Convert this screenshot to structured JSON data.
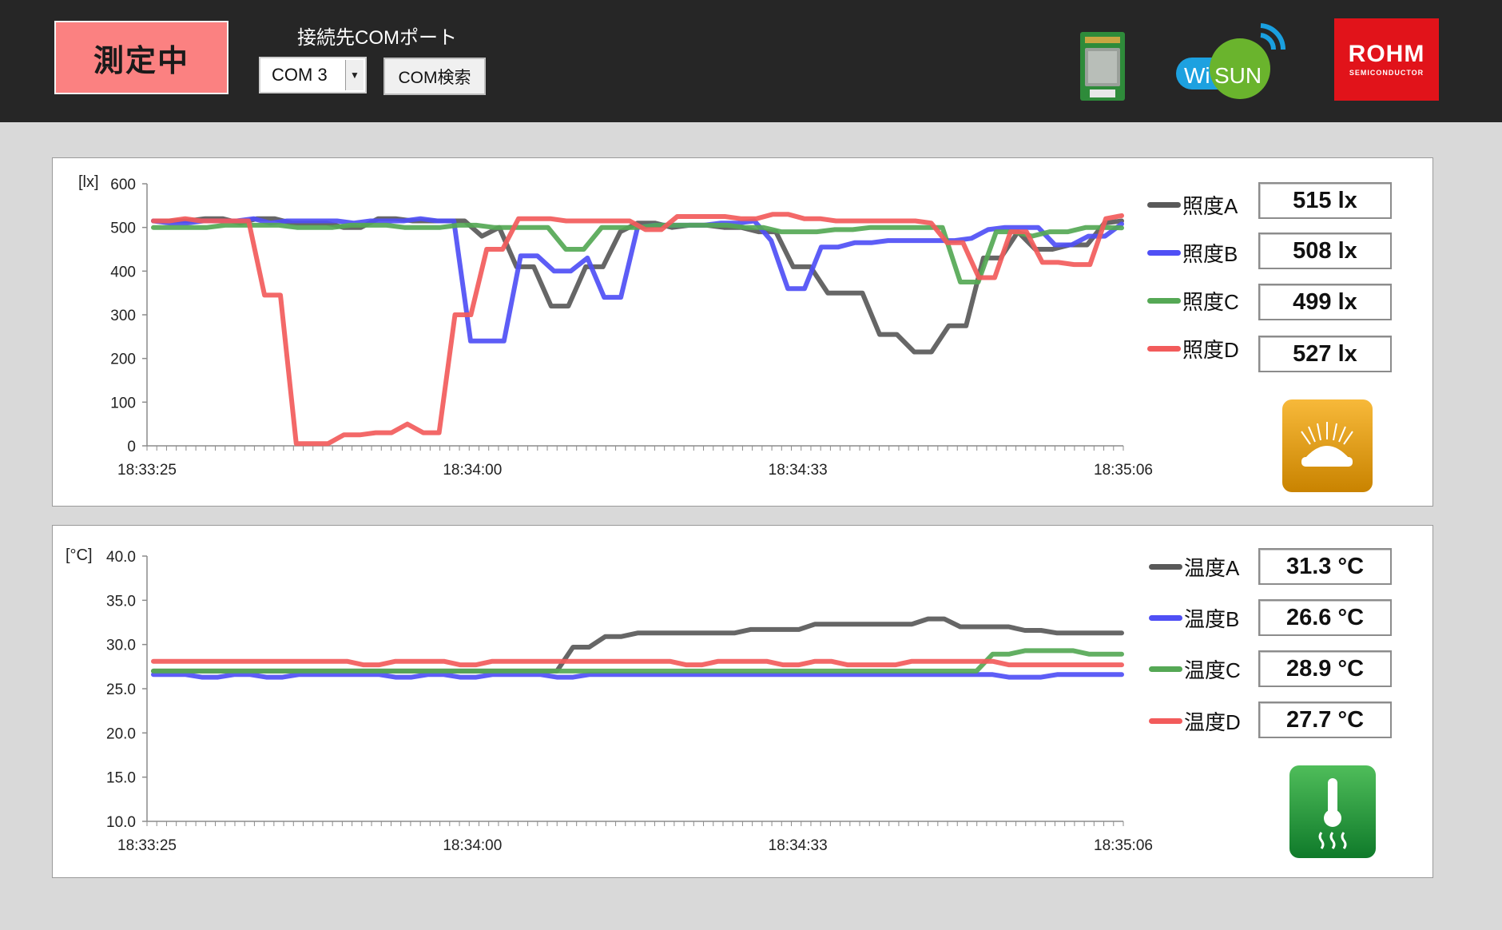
{
  "header": {
    "status_label": "測定中",
    "com_port_label": "接続先COMポート",
    "com_port_value": "COM 3",
    "com_search_label": "COM検索",
    "wisun_logo": "Wi SUN",
    "rohm_logo": "ROHM",
    "rohm_sub": "SEMICONDUCTOR"
  },
  "colors": {
    "A": "#595959",
    "B": "#4f4ff5",
    "C": "#55a855",
    "D": "#f25b5b",
    "status": "#fb8181"
  },
  "lux_panel": {
    "unit_label": "[lx]",
    "legend": [
      {
        "name": "照度A",
        "value": "515 lx"
      },
      {
        "name": "照度B",
        "value": "508 lx"
      },
      {
        "name": "照度C",
        "value": "499 lx"
      },
      {
        "name": "照度D",
        "value": "527 lx"
      }
    ],
    "icon": "light-sensor-icon"
  },
  "temp_panel": {
    "unit_label": "[°C]",
    "legend": [
      {
        "name": "温度A",
        "value": "31.3 °C"
      },
      {
        "name": "温度B",
        "value": "26.6 °C"
      },
      {
        "name": "温度C",
        "value": "28.9 °C"
      },
      {
        "name": "温度D",
        "value": "27.7 °C"
      }
    ],
    "icon": "thermometer-icon"
  },
  "chart_data": [
    {
      "type": "line",
      "ylabel": "[lx]",
      "ylim": [
        0,
        600
      ],
      "yticks": [
        "0",
        "100",
        "200",
        "300",
        "400",
        "500",
        "600"
      ],
      "xtick_labels": [
        "18:33:25",
        "18:34:00",
        "18:34:33",
        "18:35:06"
      ],
      "x": [
        0,
        2,
        4,
        6,
        8,
        10,
        12,
        14,
        16,
        18,
        20,
        22,
        24,
        26,
        28,
        30,
        32,
        34,
        36,
        38,
        40,
        42,
        44,
        46,
        48,
        50,
        52,
        54,
        56,
        58,
        60,
        62,
        64,
        66,
        68,
        70,
        72,
        74,
        76,
        78,
        80,
        82,
        84,
        86,
        88,
        90,
        92,
        94,
        96,
        98,
        100
      ],
      "series": [
        {
          "name": "照度A",
          "values": [
            515,
            515,
            515,
            520,
            520,
            510,
            520,
            520,
            510,
            510,
            510,
            500,
            500,
            520,
            520,
            515,
            515,
            515,
            515,
            480,
            500,
            410,
            410,
            320,
            320,
            410,
            410,
            490,
            510,
            510,
            500,
            505,
            505,
            500,
            500,
            490,
            490,
            410,
            410,
            350,
            350,
            350,
            255,
            255,
            215,
            215,
            275,
            275,
            430,
            430,
            490,
            450,
            450,
            460,
            460,
            510,
            515
          ]
        },
        {
          "name": "照度B",
          "values": [
            515,
            510,
            510,
            515,
            515,
            515,
            520,
            510,
            515,
            515,
            515,
            515,
            510,
            515,
            515,
            515,
            520,
            515,
            515,
            240,
            240,
            240,
            435,
            435,
            400,
            400,
            430,
            340,
            340,
            500,
            505,
            505,
            505,
            505,
            510,
            510,
            515,
            470,
            360,
            360,
            455,
            455,
            465,
            465,
            470,
            470,
            470,
            470,
            470,
            475,
            495,
            500,
            500,
            500,
            460,
            460,
            480,
            480,
            508
          ]
        },
        {
          "name": "照度C",
          "values": [
            500,
            500,
            500,
            500,
            505,
            505,
            505,
            505,
            500,
            500,
            500,
            505,
            505,
            505,
            500,
            500,
            500,
            505,
            505,
            500,
            500,
            500,
            500,
            450,
            450,
            500,
            500,
            500,
            505,
            505,
            505,
            505,
            505,
            500,
            500,
            490,
            490,
            490,
            495,
            495,
            500,
            500,
            500,
            500,
            500,
            375,
            375,
            490,
            490,
            480,
            490,
            490,
            500,
            500,
            499
          ]
        },
        {
          "name": "照度D",
          "values": [
            515,
            515,
            520,
            515,
            515,
            515,
            515,
            345,
            345,
            5,
            5,
            5,
            25,
            25,
            30,
            30,
            50,
            30,
            30,
            300,
            300,
            450,
            450,
            520,
            520,
            520,
            515,
            515,
            515,
            515,
            515,
            495,
            495,
            525,
            525,
            525,
            525,
            520,
            520,
            530,
            530,
            520,
            520,
            515,
            515,
            515,
            515,
            515,
            515,
            510,
            465,
            465,
            385,
            385,
            490,
            490,
            420,
            420,
            415,
            415,
            520,
            527
          ]
        }
      ]
    },
    {
      "type": "line",
      "ylabel": "[°C]",
      "ylim": [
        10,
        40
      ],
      "yticks": [
        "10.0",
        "15.0",
        "20.0",
        "25.0",
        "30.0",
        "35.0",
        "40.0"
      ],
      "xtick_labels": [
        "18:33:25",
        "18:34:00",
        "18:34:33",
        "18:35:06"
      ],
      "series": [
        {
          "name": "温度A",
          "values": [
            27.0,
            27.0,
            27.0,
            27.0,
            27.0,
            27.0,
            27.0,
            27.0,
            27.0,
            27.0,
            27.0,
            27.0,
            27.0,
            27.0,
            27.0,
            27.0,
            27.0,
            27.0,
            27.0,
            27.0,
            27.0,
            27.0,
            27.0,
            27.0,
            27.0,
            27.0,
            29.7,
            29.7,
            30.9,
            30.9,
            31.3,
            31.3,
            31.3,
            31.3,
            31.3,
            31.3,
            31.3,
            31.7,
            31.7,
            31.7,
            31.7,
            32.3,
            32.3,
            32.3,
            32.3,
            32.3,
            32.3,
            32.3,
            32.9,
            32.9,
            32.0,
            32.0,
            32.0,
            32.0,
            31.6,
            31.6,
            31.3,
            31.3,
            31.3,
            31.3,
            31.3
          ]
        },
        {
          "name": "温度B",
          "values": [
            26.6,
            26.6,
            26.6,
            26.3,
            26.3,
            26.6,
            26.6,
            26.3,
            26.3,
            26.6,
            26.6,
            26.6,
            26.6,
            26.6,
            26.6,
            26.3,
            26.3,
            26.6,
            26.6,
            26.3,
            26.3,
            26.6,
            26.6,
            26.6,
            26.6,
            26.3,
            26.3,
            26.6,
            26.6,
            26.6,
            26.6,
            26.6,
            26.6,
            26.6,
            26.6,
            26.6,
            26.6,
            26.6,
            26.6,
            26.6,
            26.6,
            26.6,
            26.6,
            26.6,
            26.6,
            26.6,
            26.6,
            26.6,
            26.6,
            26.6,
            26.6,
            26.6,
            26.6,
            26.3,
            26.3,
            26.3,
            26.6,
            26.6,
            26.6,
            26.6,
            26.6
          ]
        },
        {
          "name": "温度C",
          "values": [
            27.0,
            27.0,
            27.0,
            27.0,
            27.0,
            27.0,
            27.0,
            27.0,
            27.0,
            27.0,
            27.0,
            27.0,
            27.0,
            27.0,
            27.0,
            27.0,
            27.0,
            27.0,
            27.0,
            27.0,
            27.0,
            27.0,
            27.0,
            27.0,
            27.0,
            27.0,
            27.0,
            27.0,
            27.0,
            27.0,
            27.0,
            27.0,
            27.0,
            27.0,
            27.0,
            27.0,
            27.0,
            27.0,
            27.0,
            27.0,
            27.0,
            27.0,
            27.0,
            27.0,
            27.0,
            27.0,
            27.0,
            27.0,
            27.0,
            27.0,
            27.0,
            27.0,
            28.9,
            28.9,
            29.3,
            29.3,
            29.3,
            29.3,
            28.9,
            28.9,
            28.9
          ]
        },
        {
          "name": "温度D",
          "values": [
            28.1,
            28.1,
            28.1,
            28.1,
            28.1,
            28.1,
            28.1,
            28.1,
            28.1,
            28.1,
            28.1,
            28.1,
            28.1,
            27.7,
            27.7,
            28.1,
            28.1,
            28.1,
            28.1,
            27.7,
            27.7,
            28.1,
            28.1,
            28.1,
            28.1,
            28.1,
            28.1,
            28.1,
            28.1,
            28.1,
            28.1,
            28.1,
            28.1,
            27.7,
            27.7,
            28.1,
            28.1,
            28.1,
            28.1,
            27.7,
            27.7,
            28.1,
            28.1,
            27.7,
            27.7,
            27.7,
            27.7,
            28.1,
            28.1,
            28.1,
            28.1,
            28.1,
            28.1,
            27.7,
            27.7,
            27.7,
            27.7,
            27.7,
            27.7,
            27.7,
            27.7
          ]
        }
      ]
    }
  ]
}
